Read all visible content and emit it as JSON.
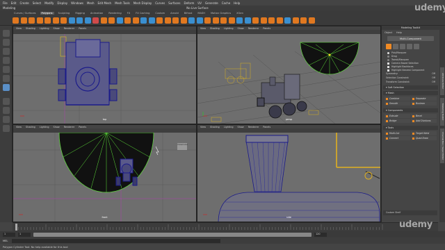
{
  "menu": [
    "File",
    "Edit",
    "Create",
    "Select",
    "Modify",
    "Display",
    "Windows",
    "Mesh",
    "Edit Mesh",
    "Mesh Tools",
    "Mesh Display",
    "Curves",
    "Surfaces",
    "Deform",
    "UV",
    "Generate",
    "Cache",
    "Help"
  ],
  "status": {
    "mode": "Modeling",
    "live": "No Live Surface"
  },
  "shelf_tabs": {
    "items": [
      "Curves / Surfaces",
      "Polygons",
      "Sculpting",
      "Rigging",
      "Animation",
      "Rendering",
      "FX",
      "FX Caching",
      "Custom",
      "Arnold",
      "Bifrost",
      "MASH",
      "Motion Graphics",
      "XGen"
    ],
    "active": "Polygons"
  },
  "viewport_menu": [
    "View",
    "Shading",
    "Lighting",
    "Show",
    "Renderer",
    "Panels"
  ],
  "viewports": {
    "top": "top",
    "persp": "persp",
    "front": "front",
    "side": "side"
  },
  "panel": {
    "title": "Modeling Toolkit",
    "tabs": [
      "Object",
      "Help"
    ],
    "make_live": "Multi-Component",
    "selection_options": [
      "Pick/Marquee",
      "Drag",
      "Tweak/Marquee"
    ],
    "checkboxes": [
      "Camera Based Selection",
      "Highlight Backfaces",
      "Highlight Nearest Component"
    ],
    "symmetry": {
      "label": "Symmetry:",
      "value": "Off"
    },
    "sel_constraint": {
      "label": "Selection Constraint:",
      "value": "Off"
    },
    "transform_constraint": {
      "label": "Transform Constraint:",
      "value": "Off"
    },
    "soft_selection": "Soft Selection",
    "sections": {
      "mesh": "Mesh",
      "mesh_tools": [
        "Combine",
        "Separate",
        "Smooth",
        "Boolean"
      ],
      "components": "Components",
      "component_tools": [
        "Extrude",
        "Bevel",
        "Bridge",
        "Add Divisions"
      ],
      "tools": "Tools",
      "tool_items": [
        "Multi-Cut",
        "Target Weld",
        "Connect",
        "Quad Draw"
      ]
    },
    "custom": "Custom Shelf"
  },
  "side_tabs": [
    "Attribute Editor",
    "Modeling Toolkit",
    "Channel Box / Layer Editor"
  ],
  "range": {
    "start": "1",
    "end": "120",
    "current": "1"
  },
  "mel": {
    "label": "MEL"
  },
  "help_line": "Polygon Cylinder Tool: No help available for this tool",
  "watermark": "udemy",
  "persp_chip": "ViewCube",
  "colors": {
    "accent": "#f08a24",
    "viewport_bg": "#6e6e6e",
    "wire_blue": "#1a1a8a",
    "cone_green": "#5fe33a"
  }
}
